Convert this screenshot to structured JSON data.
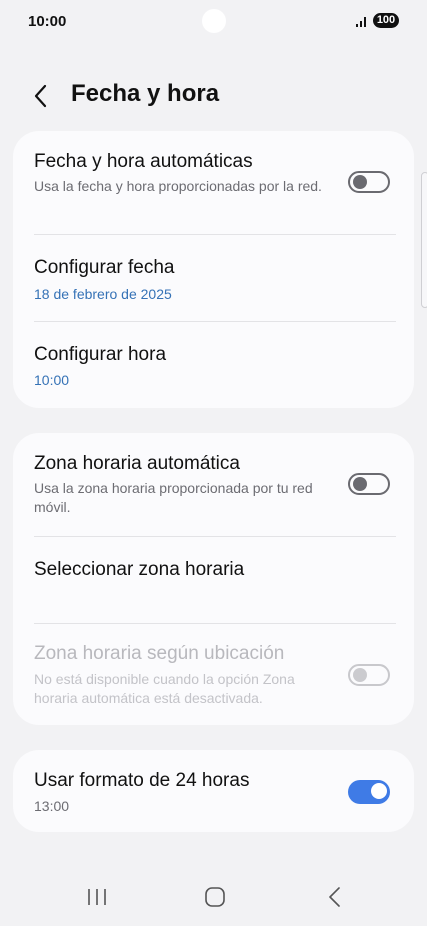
{
  "status_bar": {
    "time": "10:00",
    "battery": "100",
    "signal_icon": "signal-icon"
  },
  "header": {
    "title": "Fecha y hora",
    "back_icon": "back-arrow-icon"
  },
  "section_datetime": {
    "auto_datetime": {
      "title": "Fecha y hora automáticas",
      "subtitle": "Usa la fecha y hora proporcionadas por la red.",
      "enabled": false
    },
    "set_date": {
      "title": "Configurar fecha",
      "value": "18 de febrero de 2025"
    },
    "set_time": {
      "title": "Configurar hora",
      "value": "10:00"
    }
  },
  "section_timezone": {
    "auto_timezone": {
      "title": "Zona horaria automática",
      "subtitle": "Usa la zona horaria proporcionada por tu red móvil.",
      "enabled": false
    },
    "select_timezone": {
      "title": "Seleccionar zona horaria"
    },
    "location_timezone": {
      "title": "Zona horaria según ubicación",
      "subtitle": "No está disponible cuando la opción Zona horaria automática está desactivada.",
      "enabled": false,
      "disabled": true
    }
  },
  "section_format": {
    "use_24h": {
      "title": "Usar formato de 24 horas",
      "value": "13:00",
      "enabled": true
    }
  },
  "nav_bar": {
    "recent_icon": "recent-apps-icon",
    "home_icon": "home-icon",
    "back_icon": "back-icon"
  },
  "colors": {
    "accent": "#3f7be6",
    "value_blue": "#3572b6",
    "background": "#f2f2f4",
    "card": "#fbfbfd"
  }
}
